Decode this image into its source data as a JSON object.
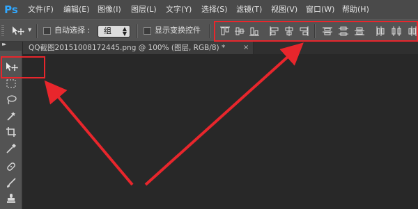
{
  "app": {
    "logo": "Ps"
  },
  "menu": [
    {
      "label": "文件(F)"
    },
    {
      "label": "编辑(E)"
    },
    {
      "label": "图像(I)"
    },
    {
      "label": "图层(L)"
    },
    {
      "label": "文字(Y)"
    },
    {
      "label": "选择(S)"
    },
    {
      "label": "滤镜(T)"
    },
    {
      "label": "视图(V)"
    },
    {
      "label": "窗口(W)"
    },
    {
      "label": "帮助(H)"
    }
  ],
  "options_bar": {
    "auto_select_label": "自动选择 :",
    "auto_select_checked": false,
    "auto_select_value": "组",
    "show_transform_label": "显示变换控件",
    "show_transform_checked": false
  },
  "document_tab": {
    "title": "QQ截图20151008172445.png @ 100% (图层, RGB/8) *"
  },
  "toolbar": {
    "collapse_glyph": "▸▸",
    "tools": [
      "move-tool",
      "marquee-tool",
      "lasso-tool",
      "magic-wand-tool",
      "crop-tool",
      "eyedropper-tool",
      "healing-brush-tool",
      "brush-tool",
      "clone-stamp-tool"
    ]
  },
  "colors": {
    "menubar": "#4a4a4a",
    "options_bar": "#535353",
    "canvas": "#282828",
    "annotation_red": "#e8262c",
    "ps_blue": "#31a8ff"
  }
}
